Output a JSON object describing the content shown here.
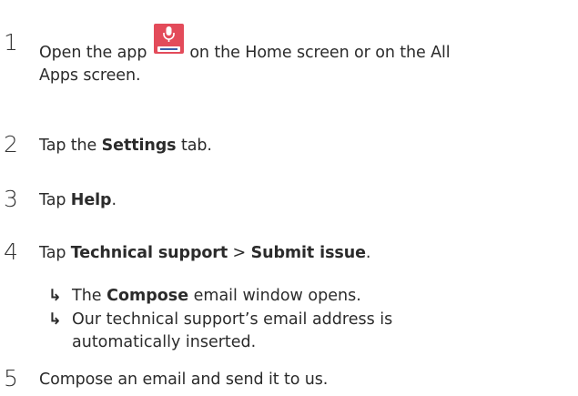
{
  "steps": [
    {
      "number": "1",
      "text_before_icon": "Open the app",
      "text_after_icon": "on the Home screen or on the All",
      "text_line2": "Apps screen.",
      "icon": "philips-voice-recorder-app-icon"
    },
    {
      "number": "2",
      "prefix": "Tap the ",
      "bold": "Settings",
      "suffix": " tab."
    },
    {
      "number": "3",
      "prefix": "Tap ",
      "bold": "Help",
      "suffix": "."
    },
    {
      "number": "4",
      "prefix": "Tap ",
      "bold": "Technical support",
      "middle": " > ",
      "bold2": "Submit issue",
      "suffix": "."
    },
    {
      "number": "5",
      "text": "Compose an email and send it to us."
    }
  ],
  "results": [
    {
      "arrow": "↳",
      "prefix": "The ",
      "bold": "Compose",
      "suffix": " email window opens."
    },
    {
      "arrow": "↳",
      "line1": "Our technical support’s email address is",
      "line2": "automatically inserted."
    }
  ],
  "colors": {
    "text": "#2b2b2b",
    "app_icon_bg": "#e34b5a"
  }
}
